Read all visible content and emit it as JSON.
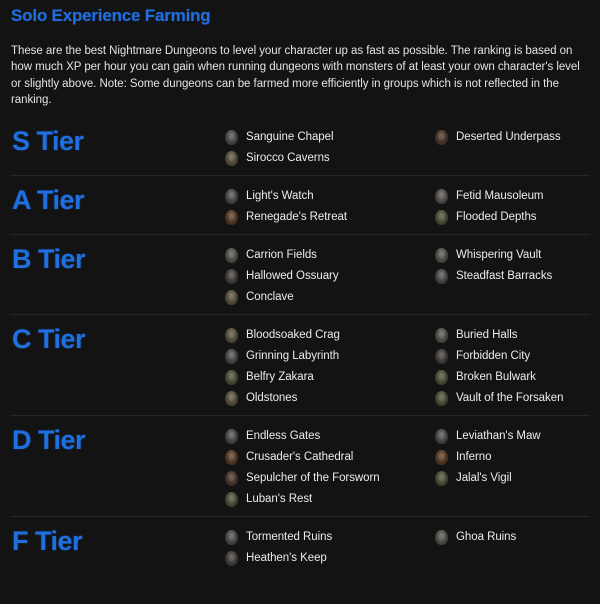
{
  "header": {
    "title": "Solo Experience Farming",
    "description": "These are the best Nightmare Dungeons to level your character up as fast as possible. The ranking is based on how much XP per hour you can gain when running dungeons with monsters of at least your own character's level or slightly above. Note: Some dungeons can be farmed more efficiently in groups which is not reflected in the ranking."
  },
  "colors": {
    "background": "#131313",
    "accent_blue": "#1f6fe0",
    "text": "#ececec",
    "divider": "#262626"
  },
  "tiers": [
    {
      "label": "S Tier",
      "left": [
        {
          "name": "Sanguine Chapel",
          "icon": "dungeon-sigil-icon",
          "tint": "ic-stone"
        },
        {
          "name": "Sirocco Caverns",
          "icon": "dungeon-sigil-icon",
          "tint": "ic-sand"
        }
      ],
      "right": [
        {
          "name": "Deserted Underpass",
          "icon": "dungeon-sigil-icon",
          "tint": "ic-blood"
        }
      ]
    },
    {
      "label": "A Tier",
      "left": [
        {
          "name": "Light's Watch",
          "icon": "dungeon-sigil-icon",
          "tint": "ic-stone"
        },
        {
          "name": "Renegade's Retreat",
          "icon": "dungeon-sigil-icon",
          "tint": "ic-fire"
        }
      ],
      "right": [
        {
          "name": "Fetid Mausoleum",
          "icon": "dungeon-sigil-icon",
          "tint": "ic-bone"
        },
        {
          "name": "Flooded Depths",
          "icon": "dungeon-sigil-icon",
          "tint": "ic-moss"
        }
      ]
    },
    {
      "label": "B Tier",
      "left": [
        {
          "name": "Carrion Fields",
          "icon": "dungeon-sigil-icon",
          "tint": "ic-bone"
        },
        {
          "name": "Hallowed Ossuary",
          "icon": "dungeon-sigil-icon",
          "tint": "ic-ash"
        },
        {
          "name": "Conclave",
          "icon": "dungeon-sigil-icon",
          "tint": "ic-sand"
        }
      ],
      "right": [
        {
          "name": "Whispering Vault",
          "icon": "dungeon-sigil-icon",
          "tint": "ic-bone"
        },
        {
          "name": "Steadfast Barracks",
          "icon": "dungeon-sigil-icon",
          "tint": "ic-stone"
        }
      ]
    },
    {
      "label": "C Tier",
      "left": [
        {
          "name": "Bloodsoaked Crag",
          "icon": "dungeon-sigil-icon",
          "tint": "ic-sand"
        },
        {
          "name": "Grinning Labyrinth",
          "icon": "dungeon-sigil-icon",
          "tint": "ic-stone"
        },
        {
          "name": "Belfry Zakara",
          "icon": "dungeon-sigil-icon",
          "tint": "ic-moss"
        },
        {
          "name": "Oldstones",
          "icon": "dungeon-sigil-icon",
          "tint": "ic-sand"
        }
      ],
      "right": [
        {
          "name": "Buried Halls",
          "icon": "dungeon-sigil-icon",
          "tint": "ic-bone"
        },
        {
          "name": "Forbidden City",
          "icon": "dungeon-sigil-icon",
          "tint": "ic-ash"
        },
        {
          "name": "Broken Bulwark",
          "icon": "dungeon-sigil-icon",
          "tint": "ic-moss"
        },
        {
          "name": "Vault of the Forsaken",
          "icon": "dungeon-sigil-icon",
          "tint": "ic-moss"
        }
      ]
    },
    {
      "label": "D Tier",
      "left": [
        {
          "name": "Endless Gates",
          "icon": "dungeon-sigil-icon",
          "tint": "ic-stone"
        },
        {
          "name": "Crusader's Cathedral",
          "icon": "dungeon-sigil-icon",
          "tint": "ic-fire"
        },
        {
          "name": "Sepulcher of the Forsworn",
          "icon": "dungeon-sigil-icon",
          "tint": "ic-blood"
        },
        {
          "name": "Luban's Rest",
          "icon": "dungeon-sigil-icon",
          "tint": "ic-moss"
        }
      ],
      "right": [
        {
          "name": "Leviathan's Maw",
          "icon": "dungeon-sigil-icon",
          "tint": "ic-stone"
        },
        {
          "name": "Inferno",
          "icon": "dungeon-sigil-icon",
          "tint": "ic-fire"
        },
        {
          "name": "Jalal's Vigil",
          "icon": "dungeon-sigil-icon",
          "tint": "ic-moss"
        }
      ]
    },
    {
      "label": "F Tier",
      "left": [
        {
          "name": "Tormented Ruins",
          "icon": "dungeon-sigil-icon",
          "tint": "ic-stone"
        },
        {
          "name": "Heathen's Keep",
          "icon": "dungeon-sigil-icon",
          "tint": "ic-ash"
        }
      ],
      "right": [
        {
          "name": "Ghoa Ruins",
          "icon": "dungeon-sigil-icon",
          "tint": "ic-bone"
        }
      ]
    }
  ]
}
